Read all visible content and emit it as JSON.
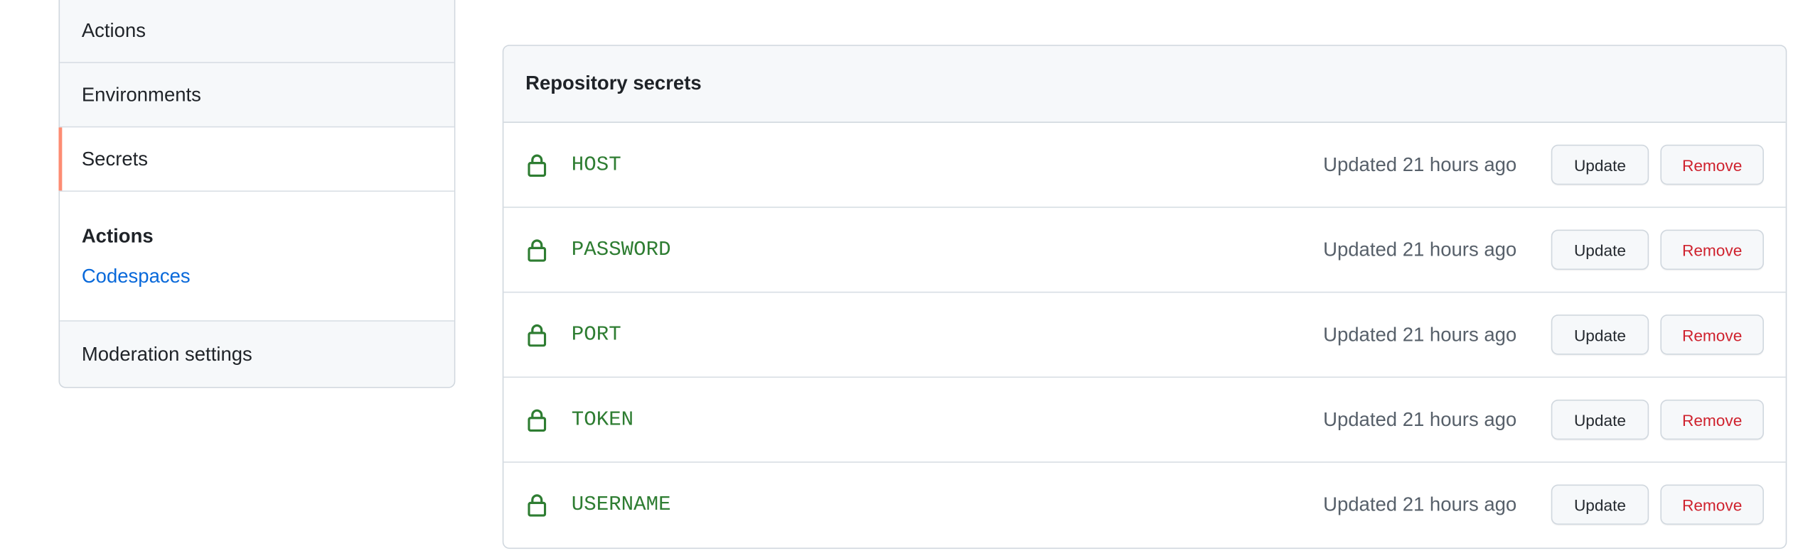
{
  "sidebar": {
    "items_top": [
      {
        "label": "Actions"
      },
      {
        "label": "Environments"
      },
      {
        "label": "Secrets",
        "selected": true
      }
    ],
    "group": {
      "title": "Actions",
      "link": "Codespaces"
    },
    "items_bottom": [
      {
        "label": "Moderation settings"
      }
    ]
  },
  "panel": {
    "title": "Repository secrets",
    "update_label": "Update",
    "remove_label": "Remove",
    "secrets": [
      {
        "name": "HOST",
        "updated": "Updated 21 hours ago"
      },
      {
        "name": "PASSWORD",
        "updated": "Updated 21 hours ago"
      },
      {
        "name": "PORT",
        "updated": "Updated 21 hours ago"
      },
      {
        "name": "TOKEN",
        "updated": "Updated 21 hours ago"
      },
      {
        "name": "USERNAME",
        "updated": "Updated 21 hours ago"
      }
    ]
  },
  "colors": {
    "accent_selected": "#fd8c73",
    "secret_name": "#2e7d32",
    "link": "#0969da",
    "danger": "#cf222e"
  },
  "icons": {
    "secret": "lock-icon"
  }
}
